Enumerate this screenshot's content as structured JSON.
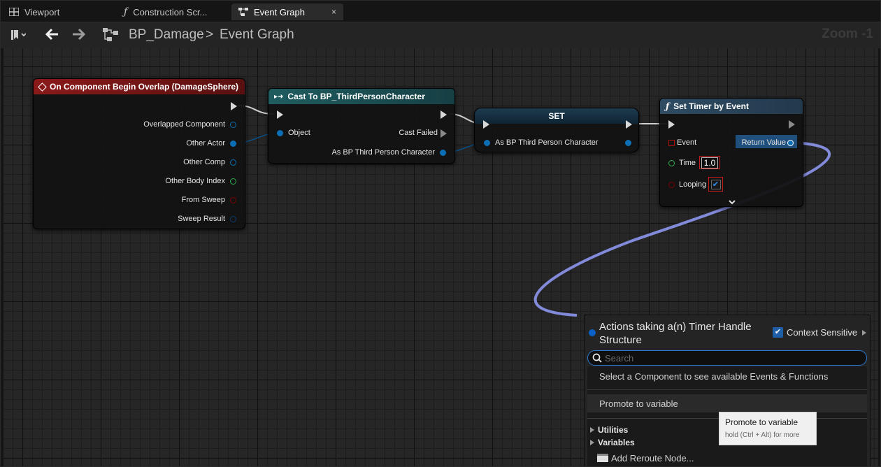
{
  "tabs": [
    {
      "label": "Viewport",
      "icon": "viewport-grid-icon"
    },
    {
      "label": "Construction Scr...",
      "icon": "function-icon"
    },
    {
      "label": "Event Graph",
      "icon": "graph-icon",
      "close": "×"
    }
  ],
  "breadcrumb": {
    "blueprint": "BP_Damage",
    "separator": ">",
    "graph": "Event Graph",
    "zoom": "Zoom -1"
  },
  "nodes": {
    "overlap": {
      "title": "On Component Begin Overlap (DamageSphere)",
      "pins": [
        "Overlapped Component",
        "Other Actor",
        "Other Comp",
        "Other Body Index",
        "From Sweep",
        "Sweep Result"
      ]
    },
    "cast": {
      "title": "Cast To BP_ThirdPersonCharacter",
      "object_pin": "Object",
      "cast_failed": "Cast Failed",
      "as_pin": "As BP Third Person Character"
    },
    "set": {
      "title": "SET",
      "pin": "As BP Third Person Character"
    },
    "timer": {
      "title": "Set Timer by Event",
      "event_pin": "Event",
      "return_pin": "Return Value",
      "time_label": "Time",
      "time_value": "1.0",
      "looping_label": "Looping",
      "looping_checked": true
    }
  },
  "action_menu": {
    "title": "Actions taking a(n) Timer Handle Structure",
    "context_sensitive_label": "Context Sensitive",
    "context_sensitive_checked": true,
    "search_placeholder": "Search",
    "items": [
      "Select a Component to see available Events & Functions",
      "Promote to variable"
    ],
    "categories": [
      "Utilities",
      "Variables"
    ],
    "reroute": "Add Reroute Node..."
  },
  "tooltip": {
    "title": "Promote to variable",
    "hint": "hold (Ctrl + Alt) for more"
  },
  "colors": {
    "event_header": "#8a1a1a",
    "cast_header": "#1f5d60",
    "set_header": "#27475c",
    "function_header": "#2f4c63",
    "object_pin": "#0c6fb5",
    "timer_wire": "#8d96ee"
  }
}
